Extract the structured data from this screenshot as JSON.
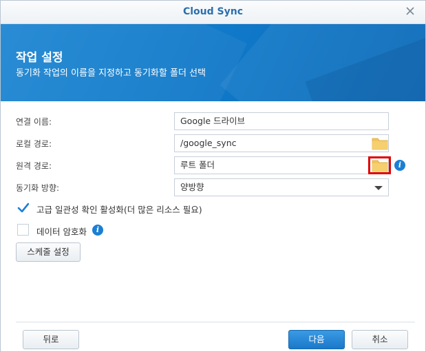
{
  "window": {
    "title": "Cloud Sync"
  },
  "banner": {
    "title": "작업 설정",
    "subtitle": "동기화 작업의 이름을 지정하고 동기화할 폴더 선택"
  },
  "form": {
    "connection_name_label": "연결 이름:",
    "connection_name_value": "Google 드라이브",
    "local_path_label": "로컬 경로:",
    "local_path_value": "/google_sync",
    "remote_path_label": "원격 경로:",
    "remote_path_value": "루트 폴더",
    "sync_direction_label": "동기화 방향:",
    "sync_direction_value": "양방향"
  },
  "options": {
    "consistency_check_label": "고급 일관성 확인 활성화(더 많은 리소스 필요)",
    "consistency_check_checked": true,
    "encrypt_label": "데이터 암호화",
    "encrypt_checked": false
  },
  "buttons": {
    "schedule": "스케줄 설정",
    "back": "뒤로",
    "next": "다음",
    "cancel": "취소"
  },
  "colors": {
    "accent": "#1a79c9",
    "folder": "#f3c45a",
    "highlight": "#e00000"
  }
}
